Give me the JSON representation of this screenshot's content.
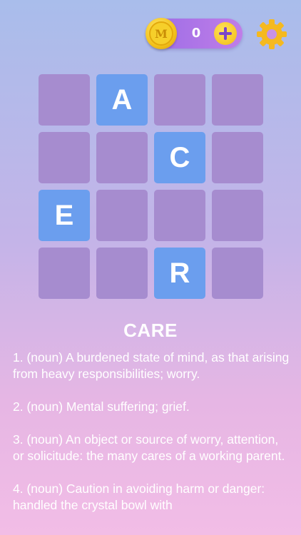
{
  "header": {
    "coin_symbol": "M",
    "coin_count": "0",
    "icons": [
      "coin-icon",
      "plus-icon",
      "gear-icon"
    ],
    "colors": {
      "gear": "#f5b91f",
      "coin": "#f3c21b",
      "pill": "#a773e7"
    }
  },
  "grid": {
    "rows": 4,
    "cols": 4,
    "cells": [
      [
        "",
        "A",
        "",
        ""
      ],
      [
        "",
        "",
        "C",
        ""
      ],
      [
        "E",
        "",
        "",
        ""
      ],
      [
        "",
        "",
        "R",
        ""
      ]
    ],
    "colors": {
      "empty": "#a68ccf",
      "letter": "#6b9eee"
    }
  },
  "result": {
    "word": "CARE",
    "definitions": [
      "1. (noun) A burdened state of mind, as that arising from heavy responsibilities; worry.",
      "2. (noun) Mental suffering; grief.",
      "3. (noun) An object or source of worry, attention, or solicitude: the many cares of a working parent.",
      "4. (noun) Caution in avoiding harm or danger: handled the crystal bowl with"
    ]
  }
}
